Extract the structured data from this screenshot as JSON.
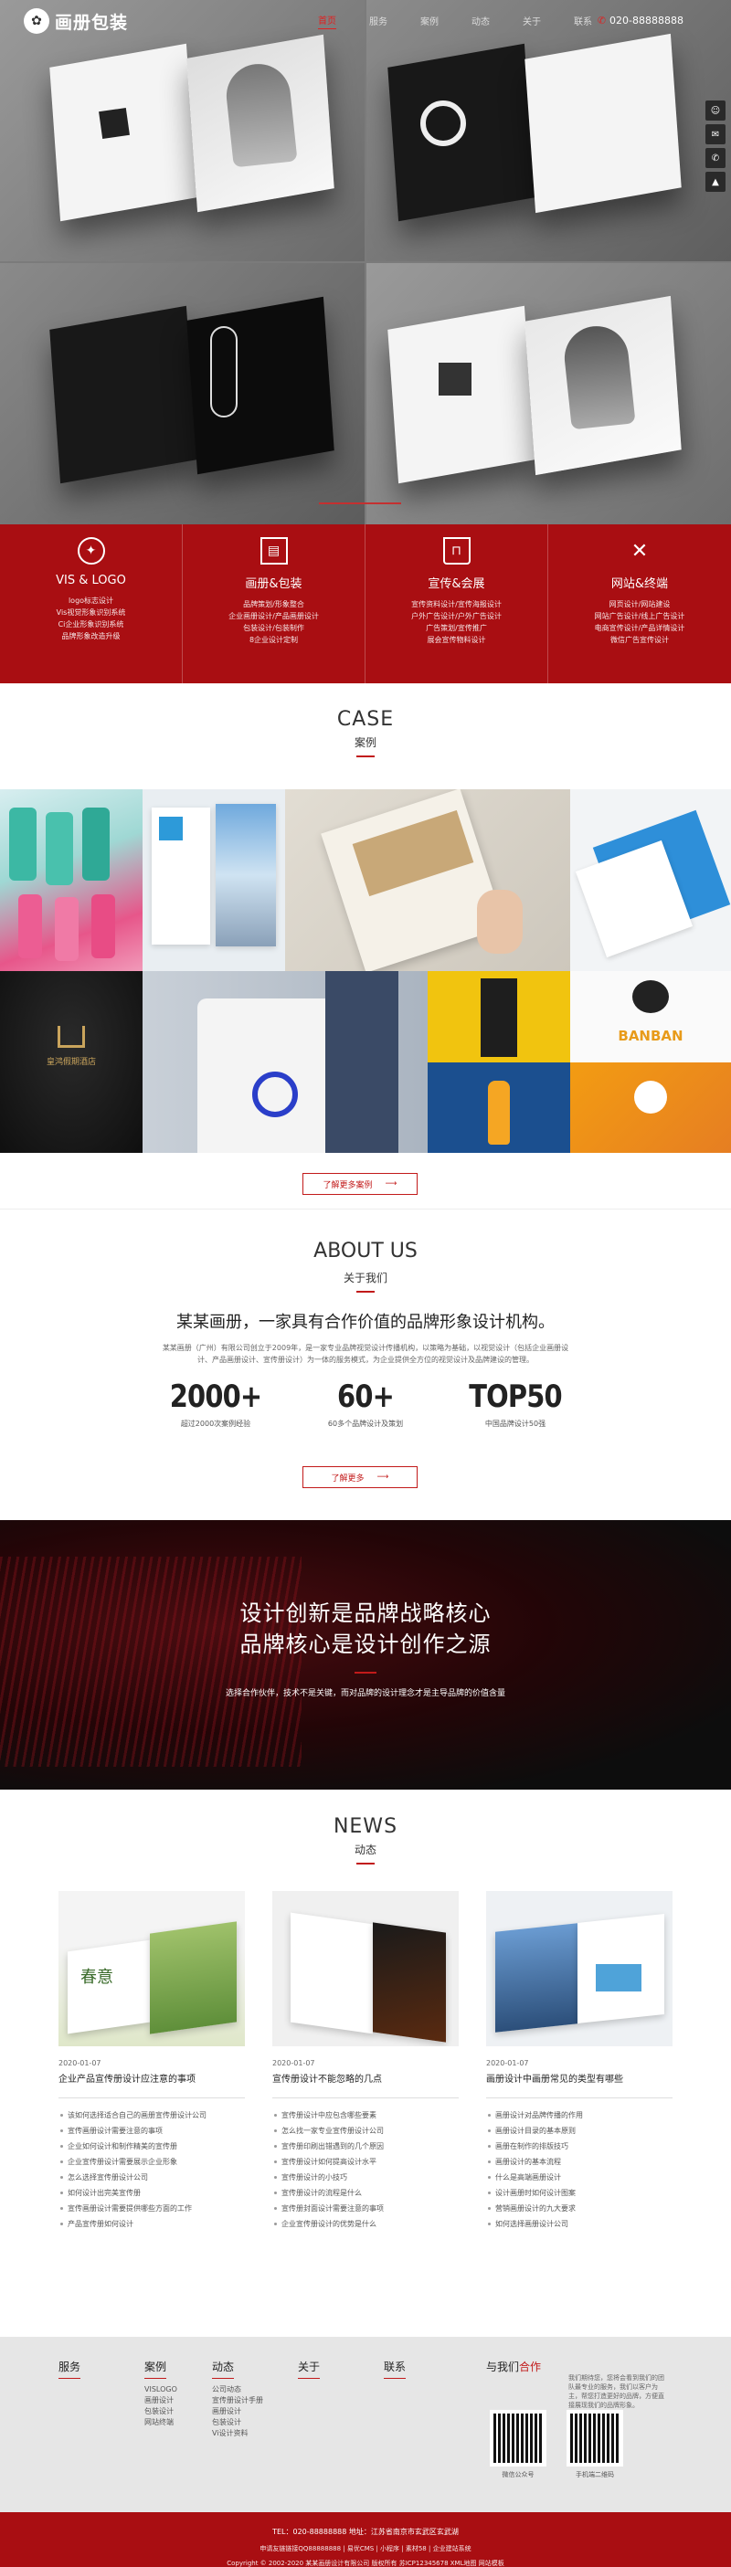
{
  "header": {
    "logo_text": "画册包装",
    "nav": [
      "首页",
      "服务",
      "案例",
      "动态",
      "关于",
      "联系"
    ],
    "phone": "020-88888888"
  },
  "services": [
    {
      "title": "VIS & LOGO",
      "items": [
        "logo标志设计",
        "Vis视觉形象识别系统",
        "Ci企业形象识别系统",
        "品牌形象改造升级"
      ]
    },
    {
      "title": "画册&包装",
      "items": [
        "品牌策划/形象整合",
        "企业画册设计/产品画册设计",
        "包装设计/包装制作",
        "8企业设计定制"
      ]
    },
    {
      "title": "宣传&会展",
      "items": [
        "宣传资料设计/宣传海报设计",
        "户外广告设计/户外广告设计",
        "广告策划/宣传推广",
        "展会宣传物料设计"
      ]
    },
    {
      "title": "网站&终端",
      "items": [
        "网页设计/网站建设",
        "网站广告设计/线上广告设计",
        "电商宣传设计/产品详情设计",
        "微信广告宣传设计"
      ]
    }
  ],
  "case": {
    "title": "CASE",
    "subtitle": "案例",
    "more_label": "了解更多案例",
    "tiles": [
      "皇鸿假期酒店",
      "BANBAN"
    ]
  },
  "about": {
    "title": "ABOUT US",
    "subtitle": "关于我们",
    "headline": "某某画册，一家具有合作价值的品牌形象设计机构。",
    "desc": "某某画册（广州）有限公司创立于2009年，是一家专业品牌视觉设计传播机构，以策略为基础，以视觉设计（包括企业画册设计、产品画册设计、宣传册设计）为一体的服务模式，为企业提供全方位的视觉设计及品牌建设的管理。",
    "stats": [
      {
        "num": "2000+",
        "label": "超过2000次案例经验"
      },
      {
        "num": "60+",
        "label": "60多个品牌设计及策划"
      },
      {
        "num": "TOP50",
        "label": "中国品牌设计50强"
      }
    ],
    "more_label": "了解更多"
  },
  "banner": {
    "line1": "设计创新是品牌战略核心",
    "line2": "品牌核心是设计创作之源",
    "desc": "选择合作伙伴，技术不是关键，而对品牌的设计理念才是主导品牌的价值含量"
  },
  "news": {
    "title": "NEWS",
    "subtitle": "动态",
    "columns": [
      {
        "date": "2020-01-07",
        "title": "企业产品宣传册设计应注意的事项",
        "img_label": "春意",
        "items": [
          "该如何选择适合自己的画册宣传册设计公司",
          "宣传画册设计需要注意的事项",
          "企业如何设计和制作精美的宣传册",
          "企业宣传册设计需要展示企业形象",
          "怎么选择宣传册设计公司",
          "如何设计出完美宣传册",
          "宣传画册设计需要提供哪些方面的工作",
          "产品宣传册如何设计"
        ]
      },
      {
        "date": "2020-01-07",
        "title": "宣传册设计不能忽略的几点",
        "img_label": "",
        "items": [
          "宣传册设计中应包含哪些要素",
          "怎么找一家专业宣传册设计公司",
          "宣传册印刷出错遇到的几个原因",
          "宣传册设计如何提高设计水平",
          "宣传册设计的小技巧",
          "宣传册设计的流程是什么",
          "宣传册封面设计需要注意的事项",
          "企业宣传册设计的优势是什么"
        ]
      },
      {
        "date": "2020-01-07",
        "title": "画册设计中画册常见的类型有哪些",
        "img_label": "",
        "items": [
          "画册设计对品牌传播的作用",
          "画册设计目录的基本原则",
          "画册在制作的排版技巧",
          "画册设计的基本流程",
          "什么是高端画册设计",
          "设计画册时如何设计图案",
          "营销画册设计的九大要求",
          "如何选择画册设计公司"
        ]
      }
    ]
  },
  "footer": {
    "columns": [
      {
        "title": "服务",
        "items": []
      },
      {
        "title": "案例",
        "items": [
          "VISLOGO",
          "画册设计",
          "包装设计",
          "网站终端"
        ]
      },
      {
        "title": "动态",
        "items": [
          "公司动态",
          "宣传册设计手册",
          "画册设计",
          "包装设计",
          "Vi设计资料"
        ]
      },
      {
        "title": "关于",
        "items": []
      },
      {
        "title": "联系",
        "items": []
      }
    ],
    "contact_title_a": "与我们",
    "contact_title_b": "合作",
    "contact_desc": "我们期待您，您将会看到我们的团队最专业的服务，我们以客户为主，帮您打造更好的品牌，方便直接展现我们的品牌形象。",
    "qr_captions": [
      "微信公众号",
      "手机端二维码"
    ],
    "copy1": "TEL：020-88888888 地址：江苏省南京市玄武区玄武湖",
    "copy2": "申请友链链接QQ88888888 | 易优CMS | 小程序 | 素材58 | 企业建站系统",
    "copy3": "Copyright © 2002-2020 某某画册设计有限公司 版权所有 苏ICP12345678 XML地图 网站模板"
  },
  "side_tools": [
    "user-icon",
    "chat-icon",
    "phone-icon",
    "top-icon"
  ],
  "colors": {
    "brand_red": "#a90e12",
    "accent_red": "#c21a1a"
  }
}
